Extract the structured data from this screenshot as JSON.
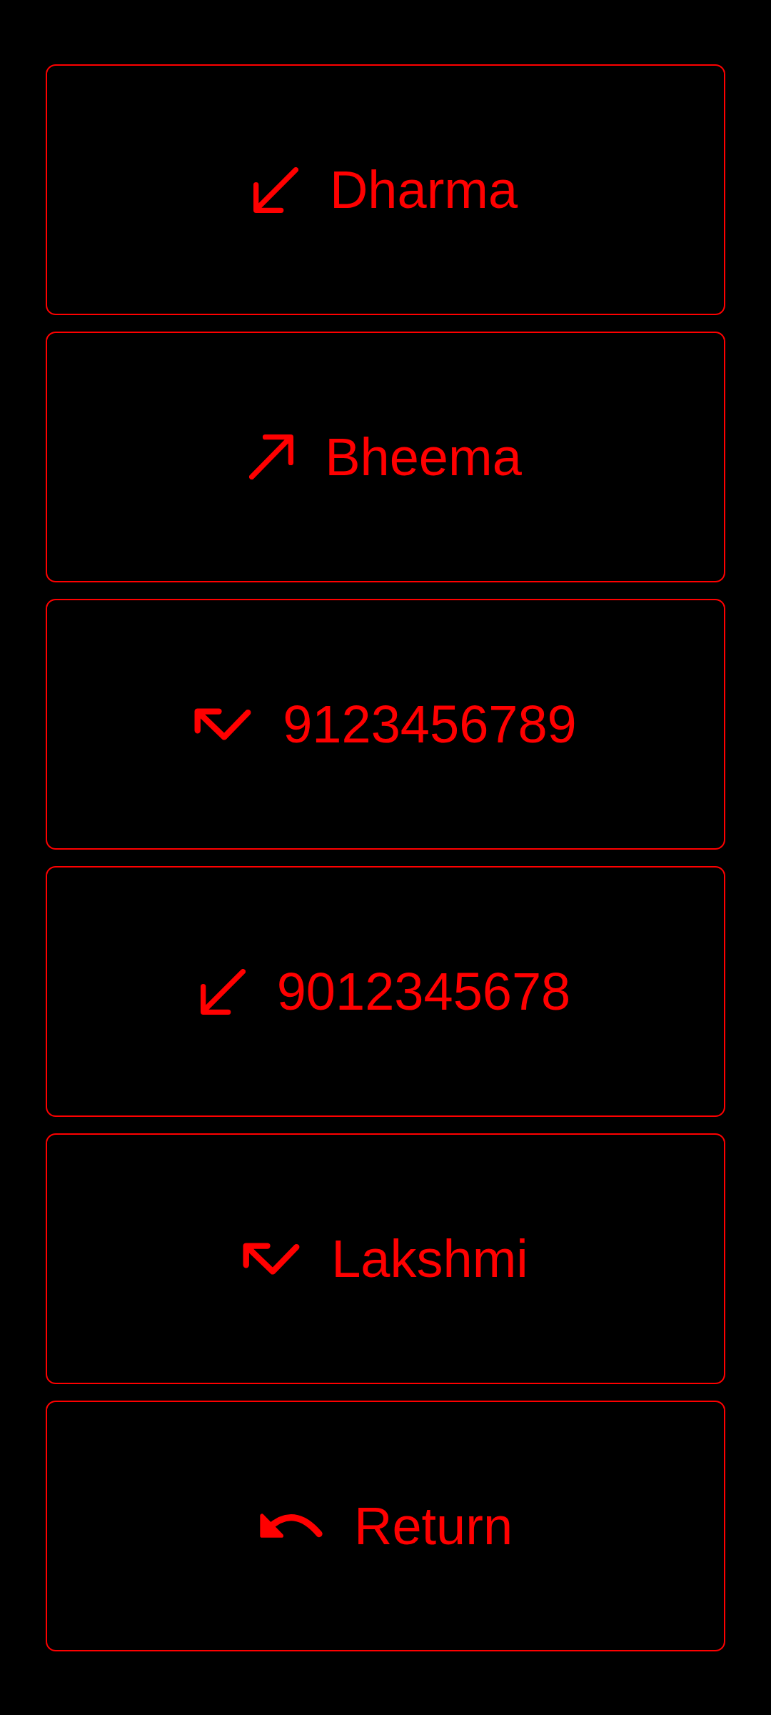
{
  "calls": [
    {
      "kind": "incoming",
      "label": "Dharma"
    },
    {
      "kind": "outgoing",
      "label": "Bheema"
    },
    {
      "kind": "missed",
      "label": "9123456789"
    },
    {
      "kind": "incoming",
      "label": "9012345678"
    },
    {
      "kind": "missed",
      "label": "Lakshmi"
    }
  ],
  "return_button": {
    "label": "Return"
  }
}
